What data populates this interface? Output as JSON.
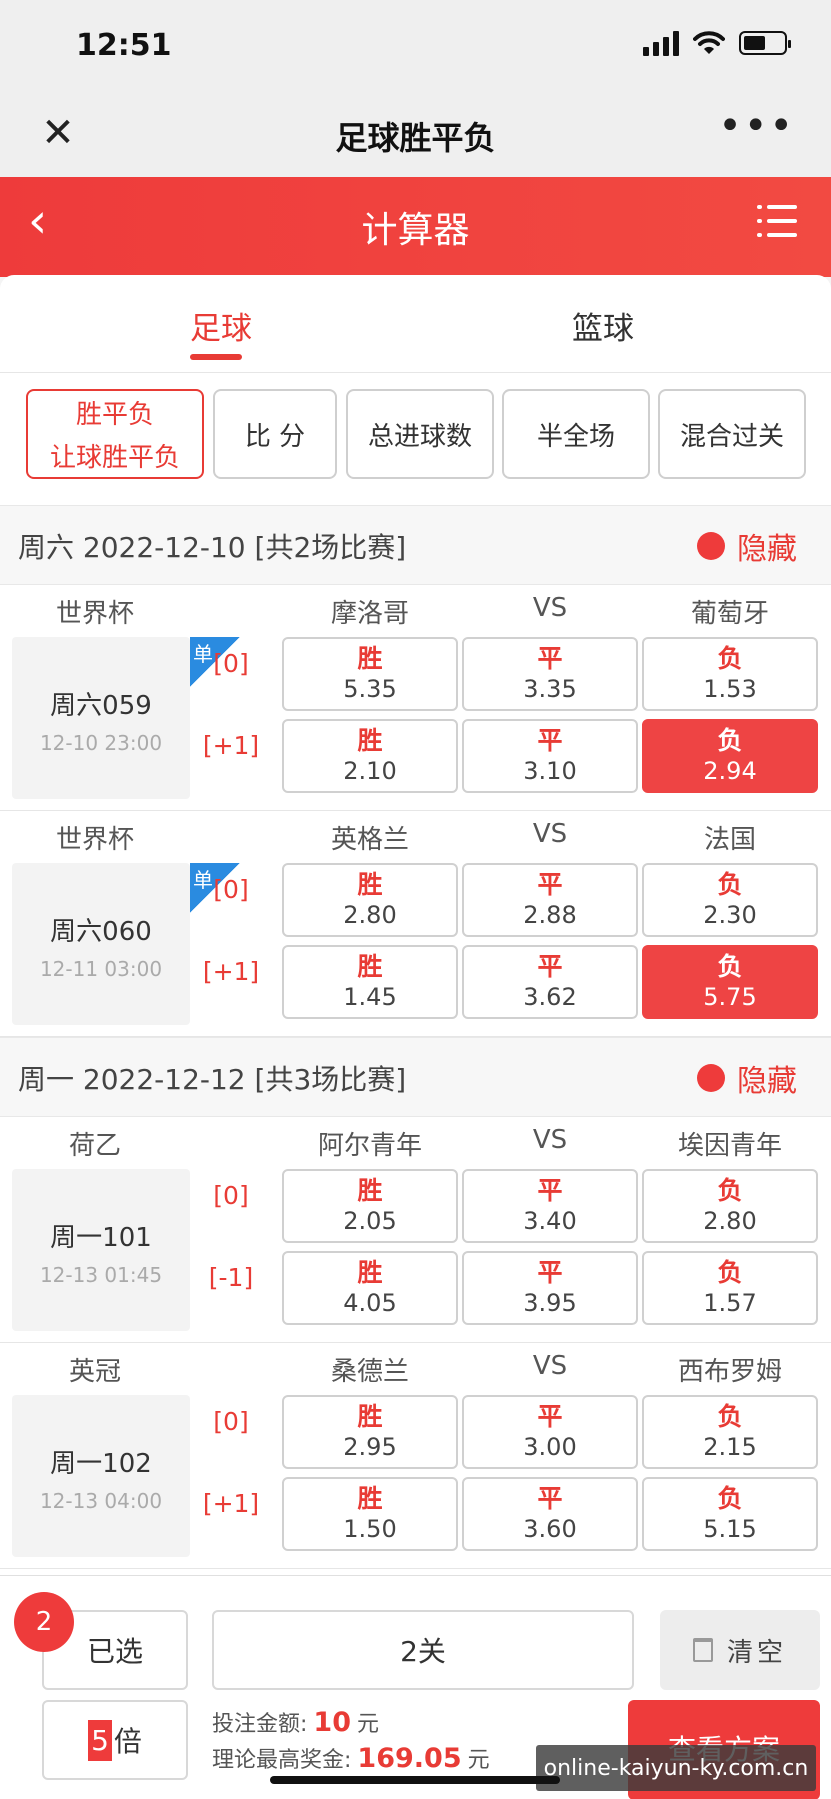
{
  "status": {
    "time": "12:51"
  },
  "nav": {
    "title": "足球胜平负",
    "close": "✕",
    "more": "•••"
  },
  "header": {
    "title": "计算器",
    "back": "‹"
  },
  "sport_tabs": [
    {
      "label": "足球",
      "active": true
    },
    {
      "label": "篮球",
      "active": false
    }
  ],
  "play_types": [
    {
      "line1": "胜平负",
      "line2": "让球胜平负",
      "active": true
    },
    {
      "line1": "比 分"
    },
    {
      "line1": "总进球数"
    },
    {
      "line1": "半全场"
    },
    {
      "line1": "混合过关"
    }
  ],
  "sections": [
    {
      "date": "周六 2022-12-10 [共2场比赛]",
      "hide": "隐藏",
      "matches": [
        {
          "league": "世界杯",
          "home": "摩洛哥",
          "vs": "VS",
          "away": "葡萄牙",
          "no": "周六059",
          "time": "12-10 23:00",
          "single": "单",
          "rows": [
            {
              "handicap": "[0]",
              "win": "胜",
              "win_odds": "5.35",
              "draw": "平",
              "draw_odds": "3.35",
              "lose": "负",
              "lose_odds": "1.53",
              "selected": ""
            },
            {
              "handicap": "[+1]",
              "win": "胜",
              "win_odds": "2.10",
              "draw": "平",
              "draw_odds": "3.10",
              "lose": "负",
              "lose_odds": "2.94",
              "selected": "lose"
            }
          ]
        },
        {
          "league": "世界杯",
          "home": "英格兰",
          "vs": "VS",
          "away": "法国",
          "no": "周六060",
          "time": "12-11 03:00",
          "single": "单",
          "rows": [
            {
              "handicap": "[0]",
              "win": "胜",
              "win_odds": "2.80",
              "draw": "平",
              "draw_odds": "2.88",
              "lose": "负",
              "lose_odds": "2.30",
              "selected": ""
            },
            {
              "handicap": "[+1]",
              "win": "胜",
              "win_odds": "1.45",
              "draw": "平",
              "draw_odds": "3.62",
              "lose": "负",
              "lose_odds": "5.75",
              "selected": "lose"
            }
          ]
        }
      ]
    },
    {
      "date": "周一 2022-12-12 [共3场比赛]",
      "hide": "隐藏",
      "matches": [
        {
          "league": "荷乙",
          "home": "阿尔青年",
          "vs": "VS",
          "away": "埃因青年",
          "no": "周一101",
          "time": "12-13 01:45",
          "single": "",
          "rows": [
            {
              "handicap": "[0]",
              "win": "胜",
              "win_odds": "2.05",
              "draw": "平",
              "draw_odds": "3.40",
              "lose": "负",
              "lose_odds": "2.80",
              "selected": ""
            },
            {
              "handicap": "[-1]",
              "win": "胜",
              "win_odds": "4.05",
              "draw": "平",
              "draw_odds": "3.95",
              "lose": "负",
              "lose_odds": "1.57",
              "selected": ""
            }
          ]
        },
        {
          "league": "英冠",
          "home": "桑德兰",
          "vs": "VS",
          "away": "西布罗姆",
          "no": "周一102",
          "time": "12-13 04:00",
          "single": "",
          "rows": [
            {
              "handicap": "[0]",
              "win": "胜",
              "win_odds": "2.95",
              "draw": "平",
              "draw_odds": "3.00",
              "lose": "负",
              "lose_odds": "2.15",
              "selected": ""
            },
            {
              "handicap": "[+1]",
              "win": "胜",
              "win_odds": "1.50",
              "draw": "平",
              "draw_odds": "3.60",
              "lose": "负",
              "lose_odds": "5.15",
              "selected": ""
            }
          ]
        }
      ]
    }
  ],
  "bottom": {
    "count": "2",
    "selected_label": "已选",
    "pass_label": "2关",
    "clear_label": "清空",
    "multiplier": "5",
    "multiplier_unit": "倍",
    "bet_label": "投注金额:",
    "bet_value": "10",
    "bet_unit": "元",
    "prize_label": "理论最高奖金:",
    "prize_value": "169.05",
    "prize_unit": "元",
    "view_label": "查看方案"
  },
  "watermark": "online-kaiyun-ky.com.cn",
  "colors": {
    "accent": "#ee3b3b",
    "single_badge": "#2a8be0"
  }
}
